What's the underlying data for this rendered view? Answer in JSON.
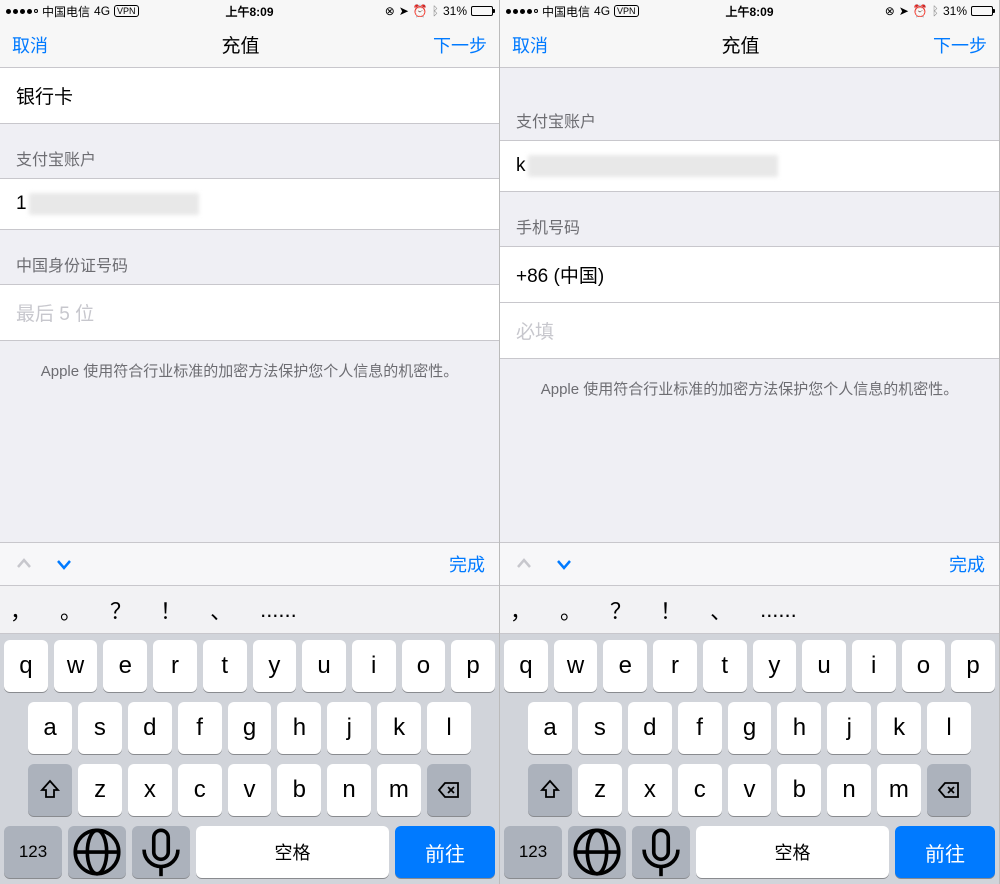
{
  "status": {
    "carrier": "中国电信",
    "network": "4G",
    "vpn": "VPN",
    "time": "上午8:09",
    "battery_pct": "31%"
  },
  "nav": {
    "cancel": "取消",
    "title": "充值",
    "next": "下一步"
  },
  "left": {
    "row1": "银行卡",
    "section1": "支付宝账户",
    "value1_prefix": "1",
    "section2": "中国身份证号码",
    "placeholder2": "最后 5 位"
  },
  "right": {
    "section1": "支付宝账户",
    "value1_prefix": "k",
    "section2": "手机号码",
    "country": "+86 (中国)",
    "placeholder2": "必填"
  },
  "footer": "Apple 使用符合行业标准的加密方法保护您个人信息的机密性。",
  "accessory": {
    "done": "完成"
  },
  "candidates": [
    "，",
    "。",
    "？",
    "！",
    "、",
    "......"
  ],
  "keyboard": {
    "row1": [
      "q",
      "w",
      "e",
      "r",
      "t",
      "y",
      "u",
      "i",
      "o",
      "p"
    ],
    "row2": [
      "a",
      "s",
      "d",
      "f",
      "g",
      "h",
      "j",
      "k",
      "l"
    ],
    "row3": [
      "z",
      "x",
      "c",
      "v",
      "b",
      "n",
      "m"
    ],
    "num": "123",
    "space": "空格",
    "go": "前往"
  }
}
